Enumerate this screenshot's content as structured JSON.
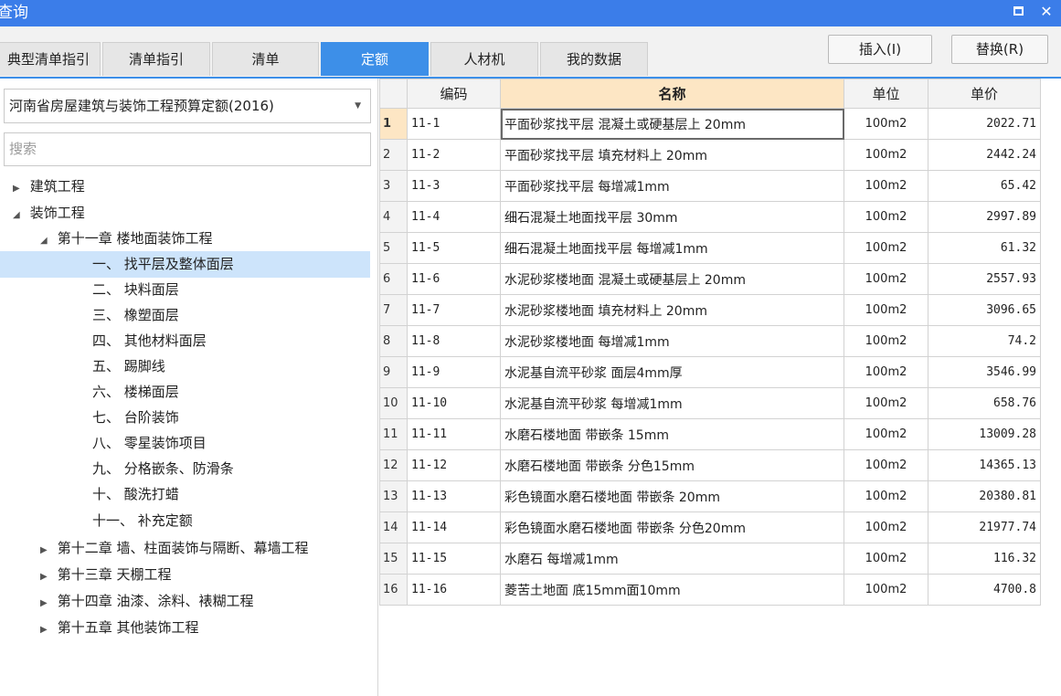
{
  "window": {
    "title": "查询"
  },
  "tabs": [
    {
      "label": "典型清单指引"
    },
    {
      "label": "清单指引"
    },
    {
      "label": "清单"
    },
    {
      "label": "定额"
    },
    {
      "label": "人材机"
    },
    {
      "label": "我的数据"
    }
  ],
  "actions": {
    "insert": "插入(I)",
    "replace": "替换(R)"
  },
  "left": {
    "library": "河南省房屋建筑与装饰工程预算定额(2016)",
    "search_placeholder": "搜索",
    "tree": [
      {
        "label": "建筑工程"
      },
      {
        "label": "装饰工程"
      },
      {
        "label": "第十一章 楼地面装饰工程"
      },
      {
        "label": "一、 找平层及整体面层"
      },
      {
        "label": "二、 块料面层"
      },
      {
        "label": "三、 橡塑面层"
      },
      {
        "label": "四、 其他材料面层"
      },
      {
        "label": "五、 踢脚线"
      },
      {
        "label": "六、 楼梯面层"
      },
      {
        "label": "七、 台阶装饰"
      },
      {
        "label": "八、 零星装饰项目"
      },
      {
        "label": "九、 分格嵌条、防滑条"
      },
      {
        "label": "十、 酸洗打蜡"
      },
      {
        "label": "十一、 补充定额"
      },
      {
        "label": "第十二章 墙、柱面装饰与隔断、幕墙工程"
      },
      {
        "label": "第十三章 天棚工程"
      },
      {
        "label": "第十四章 油漆、涂料、裱糊工程"
      },
      {
        "label": "第十五章 其他装饰工程"
      }
    ]
  },
  "grid": {
    "columns": {
      "code": "编码",
      "name": "名称",
      "unit": "单位",
      "price": "单价"
    },
    "rows": [
      {
        "no": "1",
        "code": "11-1",
        "name": "平面砂浆找平层 混凝土或硬基层上 20mm",
        "unit": "100m2",
        "price": "2022.71"
      },
      {
        "no": "2",
        "code": "11-2",
        "name": "平面砂浆找平层 填充材料上 20mm",
        "unit": "100m2",
        "price": "2442.24"
      },
      {
        "no": "3",
        "code": "11-3",
        "name": "平面砂浆找平层 每增减1mm",
        "unit": "100m2",
        "price": "65.42"
      },
      {
        "no": "4",
        "code": "11-4",
        "name": "细石混凝土地面找平层 30mm",
        "unit": "100m2",
        "price": "2997.89"
      },
      {
        "no": "5",
        "code": "11-5",
        "name": "细石混凝土地面找平层 每增减1mm",
        "unit": "100m2",
        "price": "61.32"
      },
      {
        "no": "6",
        "code": "11-6",
        "name": "水泥砂浆楼地面 混凝土或硬基层上 20mm",
        "unit": "100m2",
        "price": "2557.93"
      },
      {
        "no": "7",
        "code": "11-7",
        "name": "水泥砂浆楼地面 填充材料上 20mm",
        "unit": "100m2",
        "price": "3096.65"
      },
      {
        "no": "8",
        "code": "11-8",
        "name": "水泥砂浆楼地面 每增减1mm",
        "unit": "100m2",
        "price": "74.2"
      },
      {
        "no": "9",
        "code": "11-9",
        "name": "水泥基自流平砂浆 面层4mm厚",
        "unit": "100m2",
        "price": "3546.99"
      },
      {
        "no": "10",
        "code": "11-10",
        "name": "水泥基自流平砂浆 每增减1mm",
        "unit": "100m2",
        "price": "658.76"
      },
      {
        "no": "11",
        "code": "11-11",
        "name": "水磨石楼地面 带嵌条 15mm",
        "unit": "100m2",
        "price": "13009.28"
      },
      {
        "no": "12",
        "code": "11-12",
        "name": "水磨石楼地面 带嵌条 分色15mm",
        "unit": "100m2",
        "price": "14365.13"
      },
      {
        "no": "13",
        "code": "11-13",
        "name": "彩色镜面水磨石楼地面 带嵌条 20mm",
        "unit": "100m2",
        "price": "20380.81"
      },
      {
        "no": "14",
        "code": "11-14",
        "name": "彩色镜面水磨石楼地面 带嵌条 分色20mm",
        "unit": "100m2",
        "price": "21977.74"
      },
      {
        "no": "15",
        "code": "11-15",
        "name": "水磨石 每增减1mm",
        "unit": "100m2",
        "price": "116.32"
      },
      {
        "no": "16",
        "code": "11-16",
        "name": "菱苦土地面 底15mm面10mm",
        "unit": "100m2",
        "price": "4700.8"
      }
    ]
  },
  "colors": {
    "titlebar": "#3b7de9",
    "active_tab": "#3d8fe8",
    "selected_tree": "#cde4fb",
    "header_highlight": "#fde6c4"
  }
}
